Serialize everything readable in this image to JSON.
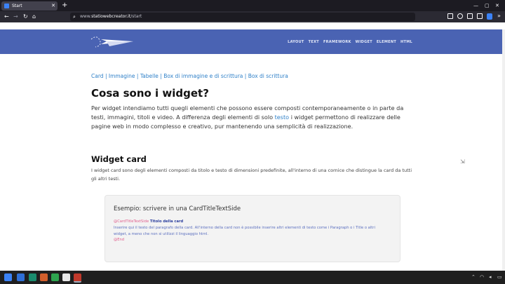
{
  "browser": {
    "tab_title": "Start",
    "url_prefix": "www.",
    "url_domain": "statiowebcreator.it",
    "url_path": "/start",
    "window_controls": [
      "—",
      "▢",
      "✕"
    ]
  },
  "site": {
    "menu": [
      "LAYOUT",
      "TEXT",
      "FRAMEWORK",
      "WIDGET",
      "ELEMENT",
      "HTML"
    ]
  },
  "breadcrumb": [
    "Card",
    "Immagine",
    "Tabelle",
    "Box di immagine e di scrittura",
    "Box di scrittura"
  ],
  "section1": {
    "title": "Cosa sono i widget?",
    "text_before": "Per widget intendiamo tutti quegli elementi che possono essere composti contemporaneamente o in parte da testi, immagini, titoli e video. A differenza degli elementi di solo ",
    "link": "testo",
    "text_after": " i widget permettono di realizzare delle pagine web in modo complesso e creativo, pur mantenendo una semplicità di realizzazione."
  },
  "section2": {
    "title": "Widget card",
    "text": "I widget card sono degli elementi composti da titolo e testo di dimensioni predefinite, all'interno di una cornice che distingue la card da tutti gli altri testi."
  },
  "example": {
    "title": "Esempio: scrivere in una CardTitleTextSide",
    "open_tag": "@CardTitleTextSide",
    "card_title": "Titolo della card",
    "body": "Inserire qui il testo del paragrafo della card. All'interno della card non è possibile inserire altri elementi di testo come i Paragraph o i Title o altri widget, a meno che non si utilizzi il linguaggio html.",
    "close_tag": "@End"
  },
  "colors": {
    "header_bg": "#4a63b3",
    "link": "#2f80c8",
    "tag": "#e05e8c",
    "code_text": "#5b6fbf"
  }
}
